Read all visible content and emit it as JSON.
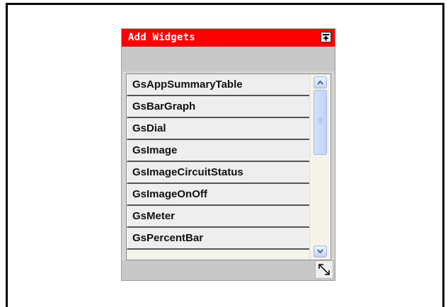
{
  "panel": {
    "title": "Add Widgets",
    "title_bar_color": "#ff0000",
    "collapse_icon": "collapse-up-icon",
    "resize_icon": "resize-diagonal-icon"
  },
  "widget_list": {
    "items": [
      "GsAppSummaryTable",
      "GsBarGraph",
      "GsDial",
      "GsImage",
      "GsImageCircuitStatus",
      "GsImageOnOff",
      "GsMeter",
      "GsPercentBar"
    ]
  }
}
